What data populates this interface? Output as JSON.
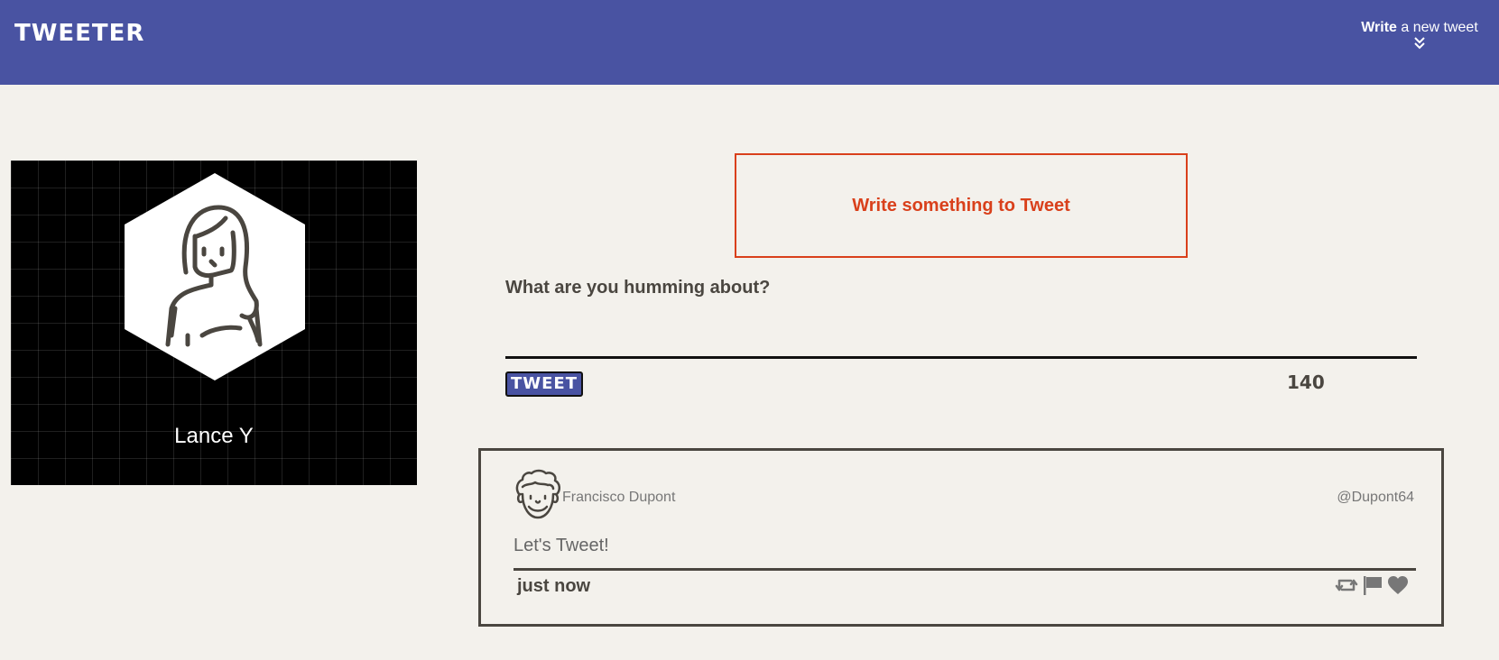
{
  "header": {
    "brand": "TWEETER",
    "write_bold": "Write",
    "write_rest": " a new tweet",
    "write_icon": "chevron-double-down-icon"
  },
  "profile": {
    "name": "Lance Y",
    "avatar_icon": "user-avatar-icon"
  },
  "composer": {
    "error_message": "Write something to Tweet",
    "label": "What are you humming about?",
    "input_value": "",
    "button_label": "TWEET",
    "char_count": "140"
  },
  "tweet": {
    "author_name": "Francisco Dupont",
    "handle": "@Dupont64",
    "text": "Let's Tweet!",
    "timestamp": "just now",
    "actions": [
      "retweet-icon",
      "flag-icon",
      "heart-icon"
    ]
  },
  "colors": {
    "header_bg": "#4953a2",
    "page_bg": "#f3f1ec",
    "error": "#d9401b",
    "text_dark": "#4a4640"
  }
}
